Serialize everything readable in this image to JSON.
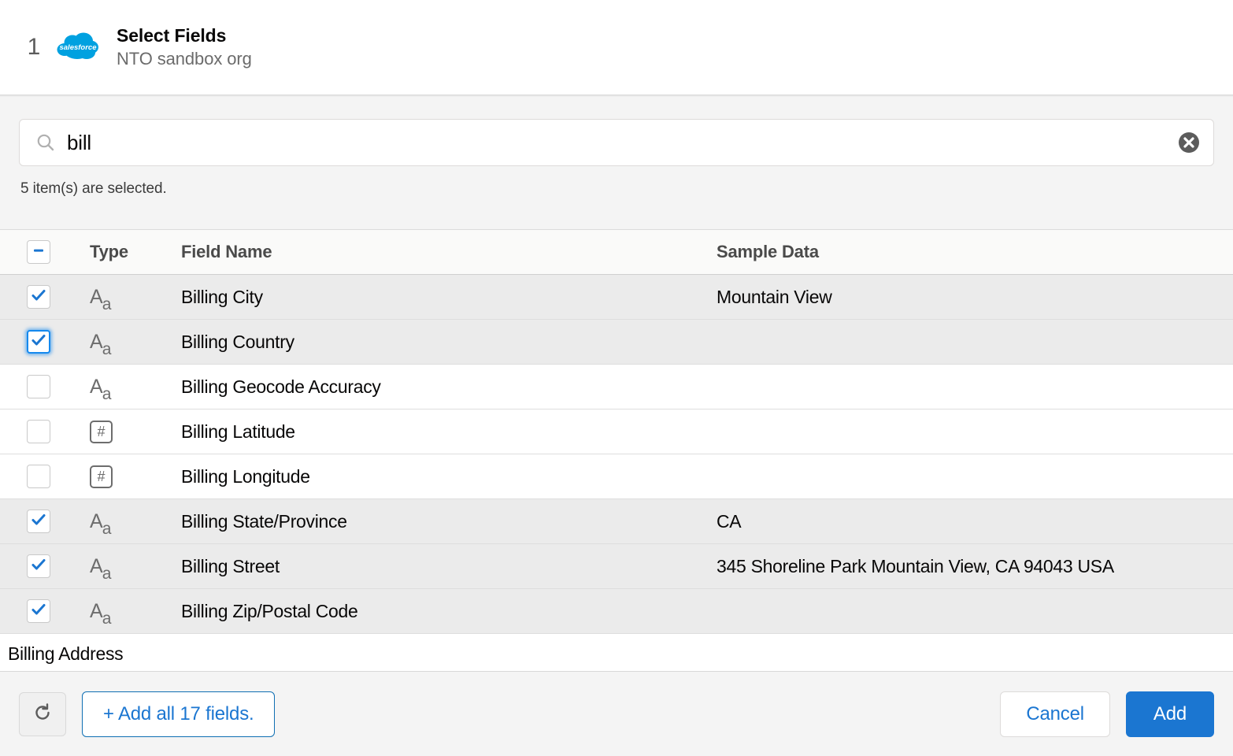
{
  "header": {
    "step_number": "1",
    "logo_text": "salesforce",
    "title": "Select Fields",
    "subtitle": "NTO sandbox org"
  },
  "search": {
    "value": "bill",
    "placeholder": "Search fields",
    "search_icon": "search-icon",
    "clear_icon": "clear-circle-x-icon"
  },
  "status": {
    "selected_text": "5 item(s) are selected."
  },
  "table": {
    "columns": {
      "type": "Type",
      "field_name": "Field Name",
      "sample_data": "Sample Data"
    },
    "header_checkbox_state": "indeterminate",
    "rows": [
      {
        "checked": true,
        "focused": false,
        "type": "text",
        "name": "Billing City",
        "sample": "Mountain View"
      },
      {
        "checked": true,
        "focused": true,
        "type": "text",
        "name": "Billing Country",
        "sample": ""
      },
      {
        "checked": false,
        "focused": false,
        "type": "text",
        "name": "Billing Geocode Accuracy",
        "sample": ""
      },
      {
        "checked": false,
        "focused": false,
        "type": "number",
        "name": "Billing Latitude",
        "sample": ""
      },
      {
        "checked": false,
        "focused": false,
        "type": "number",
        "name": "Billing Longitude",
        "sample": ""
      },
      {
        "checked": true,
        "focused": false,
        "type": "text",
        "name": "Billing State/Province",
        "sample": "CA"
      },
      {
        "checked": true,
        "focused": false,
        "type": "text",
        "name": "Billing Street",
        "sample": "345 Shoreline Park Mountain View, CA 94043 USA"
      },
      {
        "checked": true,
        "focused": false,
        "type": "text",
        "name": "Billing Zip/Postal Code",
        "sample": ""
      }
    ],
    "partial_row": {
      "name": "Billing Address"
    }
  },
  "footer": {
    "refresh_icon": "refresh-icon",
    "add_all_label": "+ Add all 17 fields.",
    "cancel_label": "Cancel",
    "add_label": "Add"
  },
  "colors": {
    "accent_blue": "#1b76d1",
    "salesforce_blue": "#00a1e0",
    "selected_row_bg": "#ebebeb",
    "panel_bg": "#f4f4f4"
  }
}
